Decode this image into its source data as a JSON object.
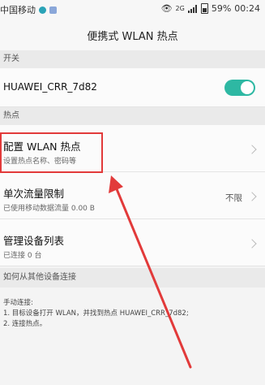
{
  "statusbar": {
    "carrier": "中国移动",
    "signal_type": "2G",
    "battery": "59%",
    "time": "00:24"
  },
  "header": {
    "title": "便携式 WLAN 热点"
  },
  "sections": {
    "switch_header": "开关",
    "hotspot_header": "热点",
    "connect_header": "如何从其他设备连接"
  },
  "switch_row": {
    "label": "HUAWEI_CRR_7d82",
    "enabled": true
  },
  "items": [
    {
      "label": "配置 WLAN 热点",
      "sub": "设置热点名称、密码等",
      "value": ""
    },
    {
      "label": "单次流量限制",
      "sub": "已使用移动数据流量 0.00 B",
      "value": "不限"
    },
    {
      "label": "管理设备列表",
      "sub": "已连接 0 台",
      "value": ""
    }
  ],
  "instructions": {
    "title": "手动连接:",
    "line1": "1. 目标设备打开 WLAN，并找到热点 HUAWEI_CRR_7d82;",
    "line2": "2. 连接热点。"
  },
  "colors": {
    "toggle_on": "#2eb8a3",
    "annotation_red": "#e23a3a"
  }
}
